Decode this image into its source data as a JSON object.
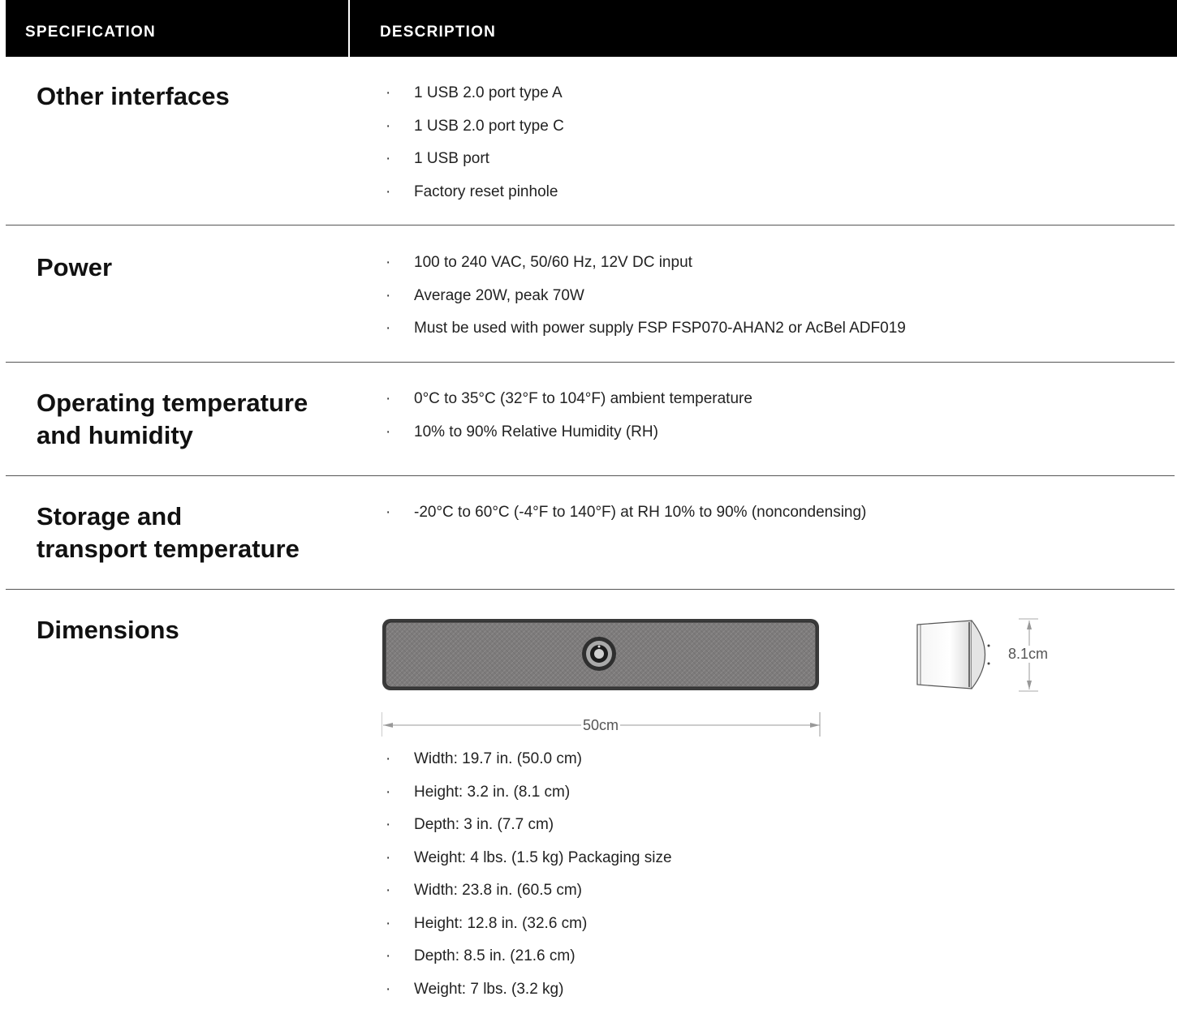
{
  "header": {
    "spec_label": "SPECIFICATION",
    "desc_label": "DESCRIPTION"
  },
  "rows": [
    {
      "label": "Other interfaces",
      "items": [
        "1 USB 2.0 port type A",
        "1 USB 2.0 port type C",
        "1 USB port",
        "Factory reset pinhole"
      ]
    },
    {
      "label": "Power",
      "items": [
        "100 to 240 VAC, 50/60 Hz, 12V DC input",
        "Average 20W, peak 70W",
        "Must be used with power supply FSP FSP070-AHAN2 or AcBel ADF019"
      ]
    },
    {
      "label": "Operating temperature\nand humidity",
      "items": [
        "0°C to 35°C (32°F to 104°F) ambient temperature",
        "10% to 90% Relative Humidity (RH)"
      ]
    },
    {
      "label": "Storage and\ntransport temperature",
      "items": [
        "-20°C to 60°C (-4°F to 140°F) at RH 10% to 90% (noncondensing)"
      ]
    },
    {
      "label": "Dimensions",
      "items": [
        "Width: 19.7 in. (50.0 cm)",
        "Height: 3.2 in. (8.1 cm)",
        "Depth: 3 in. (7.7 cm)",
        "Weight: 4 lbs. (1.5 kg) Packaging size",
        "Width: 23.8 in. (60.5 cm)",
        "Height: 12.8 in. (32.6 cm)",
        "Depth: 8.5 in. (21.6 cm)",
        "Weight: 7 lbs. (3.2 kg)"
      ]
    }
  ],
  "diagram": {
    "width_label": "50cm",
    "height_label": "8.1cm"
  },
  "colors": {
    "header_bg": "#000000",
    "header_text": "#ffffff",
    "rule": "#555555",
    "device_fabric": "#7a7878"
  }
}
